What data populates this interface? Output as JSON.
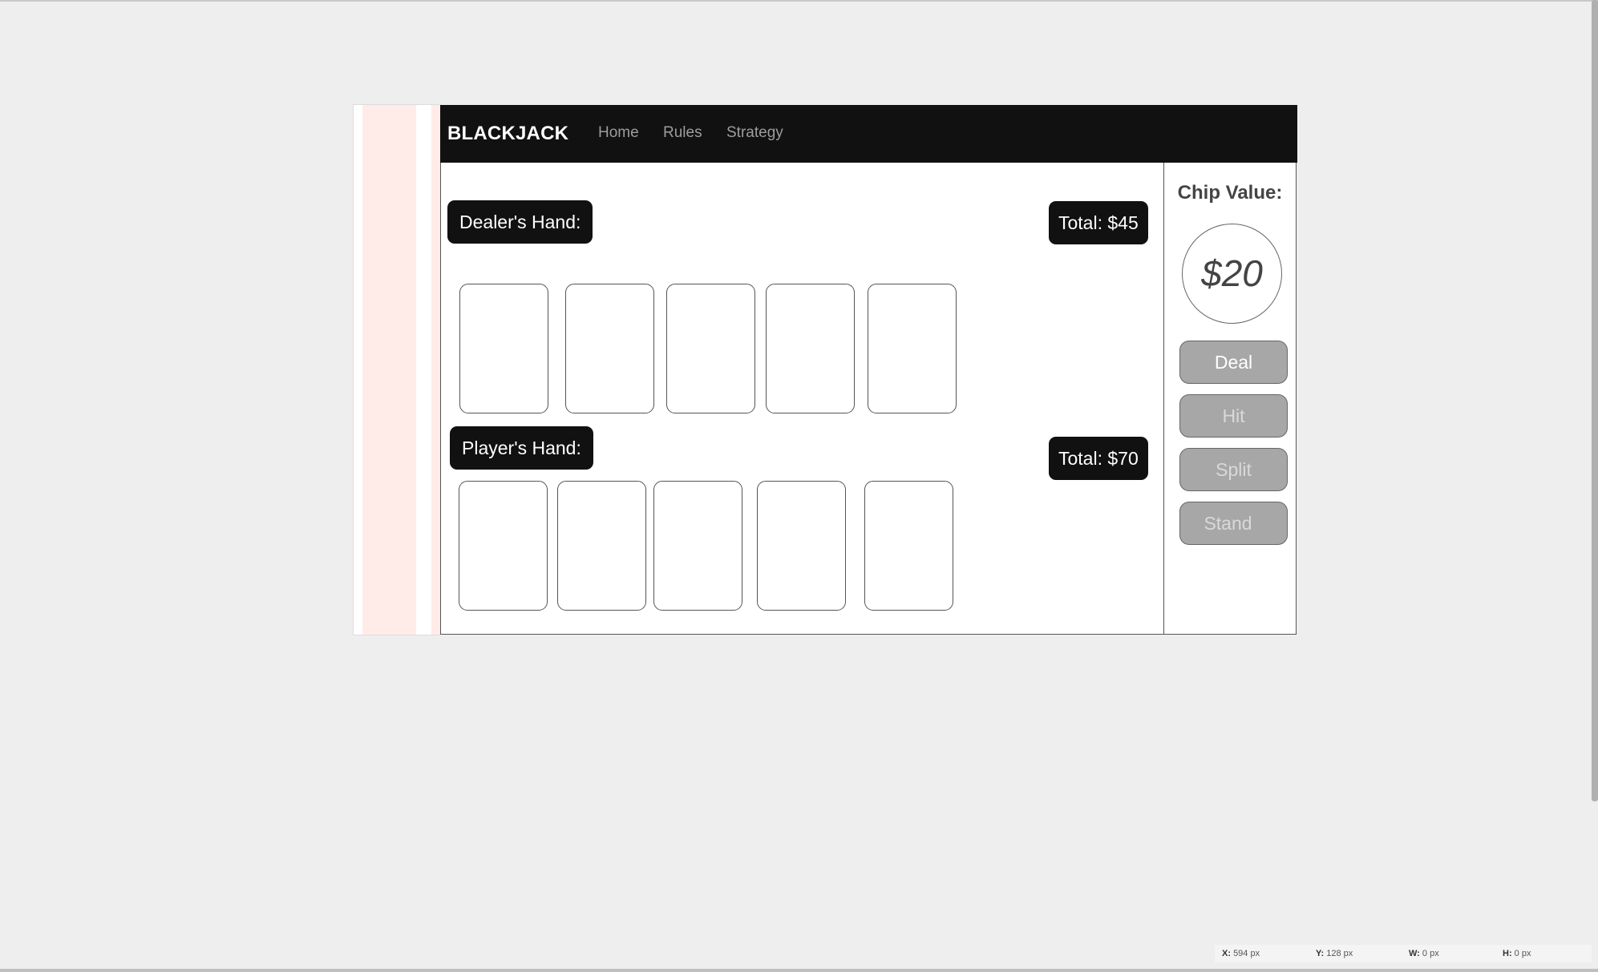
{
  "navbar": {
    "brand": "BLACKJACK",
    "links": [
      {
        "label": "Home"
      },
      {
        "label": "Rules"
      },
      {
        "label": "Strategy"
      }
    ]
  },
  "dealer": {
    "label": "Dealer's Hand:",
    "total": "Total: $45"
  },
  "player": {
    "label": "Player's Hand:",
    "total": "Total: $70"
  },
  "sidebar": {
    "chip_title": "Chip Value:",
    "chip_value": "$20",
    "buttons": [
      {
        "label": "Deal",
        "enabled": true
      },
      {
        "label": "Hit",
        "enabled": false
      },
      {
        "label": "Split",
        "enabled": false
      },
      {
        "label": "Stand",
        "enabled": false
      }
    ]
  },
  "status": {
    "x_label": "X:",
    "x_value": "594 px",
    "y_label": "Y:",
    "y_value": "128 px",
    "w_label": "W:",
    "w_value": "0 px",
    "h_label": "H:",
    "h_value": "0 px"
  },
  "colors": {
    "navbar_bg": "#111111",
    "pill_bg": "#111111",
    "button_bg": "#a7a7a7",
    "button_enabled_text": "#ffffff",
    "button_disabled_text": "#d9d9d9",
    "side_strip_pink": "#ffece8"
  }
}
